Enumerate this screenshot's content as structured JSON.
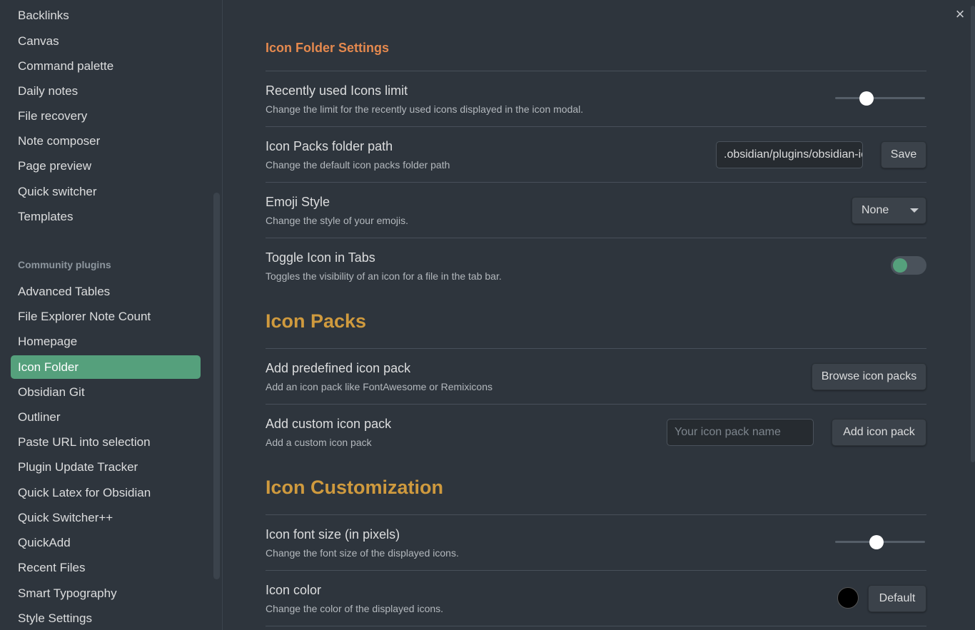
{
  "sidebar": {
    "core_items": [
      {
        "label": "Backlinks"
      },
      {
        "label": "Canvas"
      },
      {
        "label": "Command palette"
      },
      {
        "label": "Daily notes"
      },
      {
        "label": "File recovery"
      },
      {
        "label": "Note composer"
      },
      {
        "label": "Page preview"
      },
      {
        "label": "Quick switcher"
      },
      {
        "label": "Templates"
      }
    ],
    "community_heading": "Community plugins",
    "community_items": [
      {
        "label": "Advanced Tables"
      },
      {
        "label": "File Explorer Note Count"
      },
      {
        "label": "Homepage"
      },
      {
        "label": "Icon Folder",
        "active": true
      },
      {
        "label": "Obsidian Git"
      },
      {
        "label": "Outliner"
      },
      {
        "label": "Paste URL into selection"
      },
      {
        "label": "Plugin Update Tracker"
      },
      {
        "label": "Quick Latex for Obsidian"
      },
      {
        "label": "Quick Switcher++"
      },
      {
        "label": "QuickAdd"
      },
      {
        "label": "Recent Files"
      },
      {
        "label": "Smart Typography"
      },
      {
        "label": "Style Settings"
      }
    ]
  },
  "main": {
    "close_icon": "×",
    "title": "Icon Folder Settings",
    "settings": {
      "recent_limit": {
        "name": "Recently used Icons limit",
        "desc": "Change the limit for the recently used icons displayed in the icon modal.",
        "slider_fraction": 0.32
      },
      "folder_path": {
        "name": "Icon Packs folder path",
        "desc": "Change the default icon packs folder path",
        "value": ".obsidian/plugins/obsidian-icon-folder/icons",
        "save_label": "Save"
      },
      "emoji_style": {
        "name": "Emoji Style",
        "desc": "Change the style of your emojis.",
        "selected": "None"
      },
      "toggle_tabs": {
        "name": "Toggle Icon in Tabs",
        "desc": "Toggles the visibility of an icon for a file in the tab bar.",
        "enabled": false
      }
    },
    "icon_packs": {
      "heading": "Icon Packs",
      "predefined": {
        "name": "Add predefined icon pack",
        "desc": "Add an icon pack like FontAwesome or Remixicons",
        "button": "Browse icon packs"
      },
      "custom": {
        "name": "Add custom icon pack",
        "desc": "Add a custom icon pack",
        "placeholder": "Your icon pack name",
        "button": "Add icon pack"
      }
    },
    "customization": {
      "heading": "Icon Customization",
      "font_size": {
        "name": "Icon font size (in pixels)",
        "desc": "Change the font size of the displayed icons.",
        "slider_fraction": 0.45
      },
      "color": {
        "name": "Icon color",
        "desc": "Change the color of the displayed icons.",
        "value": "#000000",
        "button": "Default"
      }
    }
  },
  "colors": {
    "accent": "#55a07c",
    "section_title": "#e5894e",
    "heading": "#cf9a3e",
    "background": "#2e353d"
  }
}
